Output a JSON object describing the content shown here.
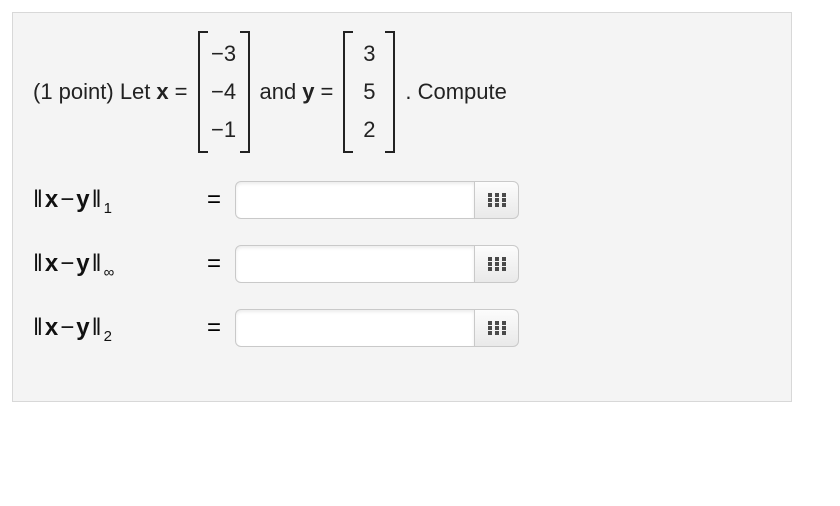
{
  "problem": {
    "points_prefix": "(1 point) Let ",
    "var_x_name": "x",
    "eq1": " = ",
    "x_vector": [
      "−3",
      "−4",
      "−1"
    ],
    "mid_text": " and ",
    "var_y_name": "y",
    "eq2": " = ",
    "y_vector": [
      "3",
      "5",
      "2"
    ],
    "tail_text": ". Compute"
  },
  "icons": {
    "keypad": "keypad-icon"
  },
  "answers": [
    {
      "expr_pre": "‖",
      "expr_x": "x",
      "expr_minus": " − ",
      "expr_y": "y",
      "expr_post": "‖",
      "subscript": "1",
      "equals": "=",
      "value": "",
      "placeholder": ""
    },
    {
      "expr_pre": "‖",
      "expr_x": "x",
      "expr_minus": " − ",
      "expr_y": "y",
      "expr_post": "‖",
      "subscript": "∞",
      "equals": "=",
      "value": "",
      "placeholder": ""
    },
    {
      "expr_pre": "‖",
      "expr_x": "x",
      "expr_minus": " − ",
      "expr_y": "y",
      "expr_post": "‖",
      "subscript": "2",
      "equals": "=",
      "value": "",
      "placeholder": ""
    }
  ]
}
